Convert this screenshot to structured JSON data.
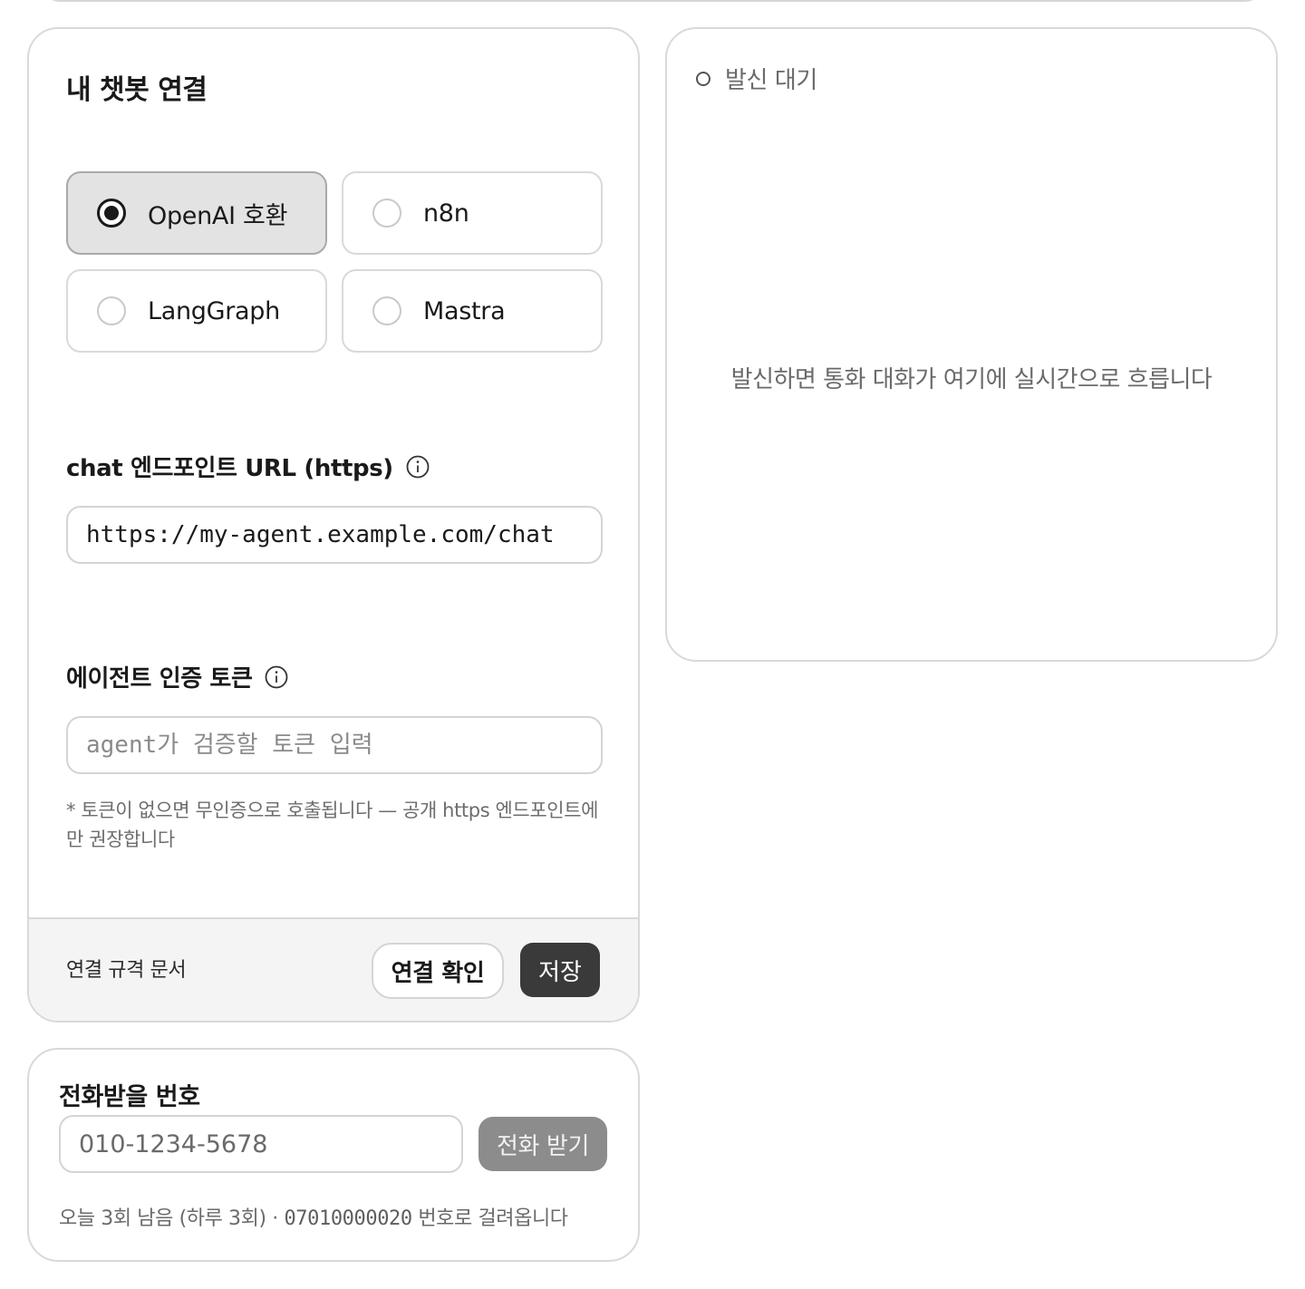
{
  "connect": {
    "title": "내 챗봇 연결",
    "options": [
      {
        "label": "OpenAI 호환",
        "selected": true
      },
      {
        "label": "n8n",
        "selected": false
      },
      {
        "label": "LangGraph",
        "selected": false
      },
      {
        "label": "Mastra",
        "selected": false
      }
    ],
    "url_label": "chat 엔드포인트 URL (https)",
    "url_value": "https://my-agent.example.com/chat",
    "token_label": "에이전트 인증 토큰",
    "token_placeholder": "agent가 검증할 토큰 입력",
    "hint": "* 토큰이 없으면 무인증으로 호출됩니다 — 공개 https 엔드포인트에만 권장합니다",
    "spec_link": "연결 규격 문서",
    "test_button": "연결 확인",
    "save_button": "저장"
  },
  "call_panel": {
    "status": "발신 대기",
    "empty_message": "발신하면 통화 대화가 여기에 실시간으로 흐릅니다"
  },
  "phone": {
    "label": "전화받을 번호",
    "placeholder": "010-1234-5678",
    "call_button": "전화 받기",
    "quota_text": "오늘 3회 남음 (하루 3회) · ",
    "caller_number": "07010000020",
    "quota_suffix": " 번호로 걸려옵니다"
  },
  "colors": {
    "save_button_bg": "#3a3a3a",
    "call_button_bg": "#8c8c8c",
    "selected_option_bg": "#e3e3e3"
  }
}
